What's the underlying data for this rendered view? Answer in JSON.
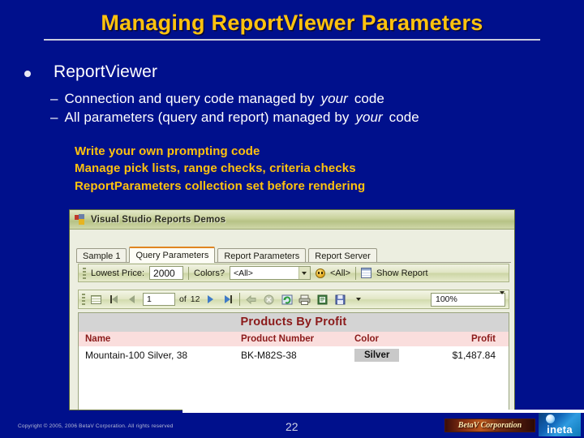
{
  "slide": {
    "title": "Managing ReportViewer Parameters",
    "bullet_level1": "ReportViewer",
    "bullet_level2": [
      {
        "dash": "–",
        "pre": "Connection and query code managed by ",
        "em": "your",
        "post": " code"
      },
      {
        "dash": "–",
        "pre": "All parameters (query and report) managed by ",
        "em": "your",
        "post": " code"
      }
    ],
    "notes": [
      "Write your own prompting code",
      "Manage pick lists, range checks, criteria checks",
      "ReportParameters collection set before rendering"
    ]
  },
  "screenshot": {
    "window_title": "Visual Studio Reports Demos",
    "tabs": [
      {
        "label": "Sample 1",
        "active": false
      },
      {
        "label": "Query Parameters",
        "active": true
      },
      {
        "label": "Report Parameters",
        "active": false
      },
      {
        "label": "Report Server",
        "active": false
      }
    ],
    "param_toolbar": {
      "lowest_price_label": "Lowest Price:",
      "lowest_price_value": "2000",
      "colors_label": "Colors?",
      "colors_value": "<All>",
      "second_value": "<All>",
      "show_report_label": "Show Report"
    },
    "viewer_toolbar": {
      "current_page": "1",
      "of_label": "of",
      "total_pages": "12",
      "zoom_value": "100%"
    },
    "report": {
      "title": "Products By Profit",
      "columns": [
        "Name",
        "Product Number",
        "Color",
        "Profit"
      ],
      "rows": [
        {
          "name": "Mountain-100 Silver, 38",
          "product_number": "BK-M82S-38",
          "color": "Silver",
          "profit": "$1,487.84"
        }
      ]
    }
  },
  "footer": {
    "copyright": "Copyright © 2005, 2006 BetaV Corporation. All rights reserved",
    "page_number": "22",
    "logo_betav": "BetaV Corporation",
    "logo_ineta": "ineta"
  },
  "colors": {
    "background": "#00108c",
    "title": "#ffc20e",
    "body_text": "#ffffff",
    "note_text": "#ffc20e",
    "tab_active_accent": "#e08521",
    "report_heading": "#8b1a1a"
  }
}
